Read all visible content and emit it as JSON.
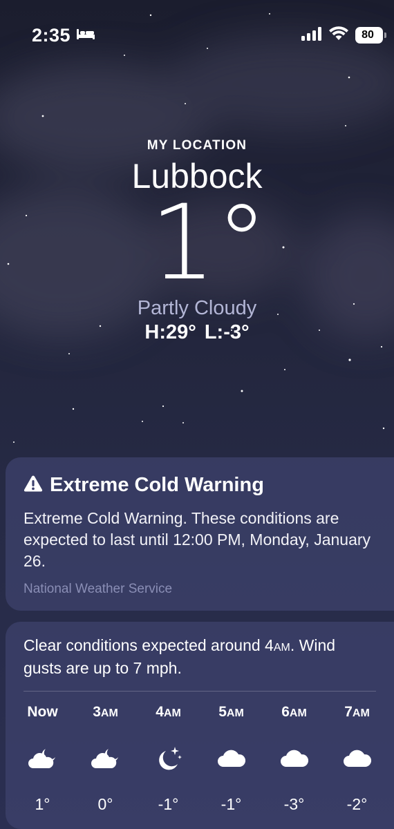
{
  "status_bar": {
    "time": "2:35",
    "battery": "80",
    "icons": [
      "bed-icon",
      "cellular-signal-icon",
      "wifi-icon",
      "battery-icon"
    ]
  },
  "header": {
    "location_label": "MY LOCATION",
    "city": "Lubbock",
    "temperature": "1°",
    "condition": "Partly Cloudy",
    "high": "H:29°",
    "low": "L:-3°"
  },
  "alert": {
    "icon": "warning-triangle-icon",
    "title": "Extreme Cold Warning",
    "body": "Extreme Cold Warning. These conditions are expected to last until 12:00 PM, Monday, January 26.",
    "source": "National Weather Service"
  },
  "forecast": {
    "summary_prefix": "Clear conditions expected around 4",
    "summary_ampm": "am",
    "summary_suffix": ". Wind gusts are up to 7 mph.",
    "hours": [
      {
        "label": "Now",
        "ampm": "",
        "icon": "cloud-moon-icon",
        "temp": "1°"
      },
      {
        "label": "3",
        "ampm": "AM",
        "icon": "cloud-moon-icon",
        "temp": "0°"
      },
      {
        "label": "4",
        "ampm": "AM",
        "icon": "moon-stars-icon",
        "temp": "-1°"
      },
      {
        "label": "5",
        "ampm": "AM",
        "icon": "cloud-icon",
        "temp": "-1°"
      },
      {
        "label": "6",
        "ampm": "AM",
        "icon": "cloud-icon",
        "temp": "-3°"
      },
      {
        "label": "7",
        "ampm": "AM",
        "icon": "cloud-icon",
        "temp": "-2°"
      }
    ]
  }
}
